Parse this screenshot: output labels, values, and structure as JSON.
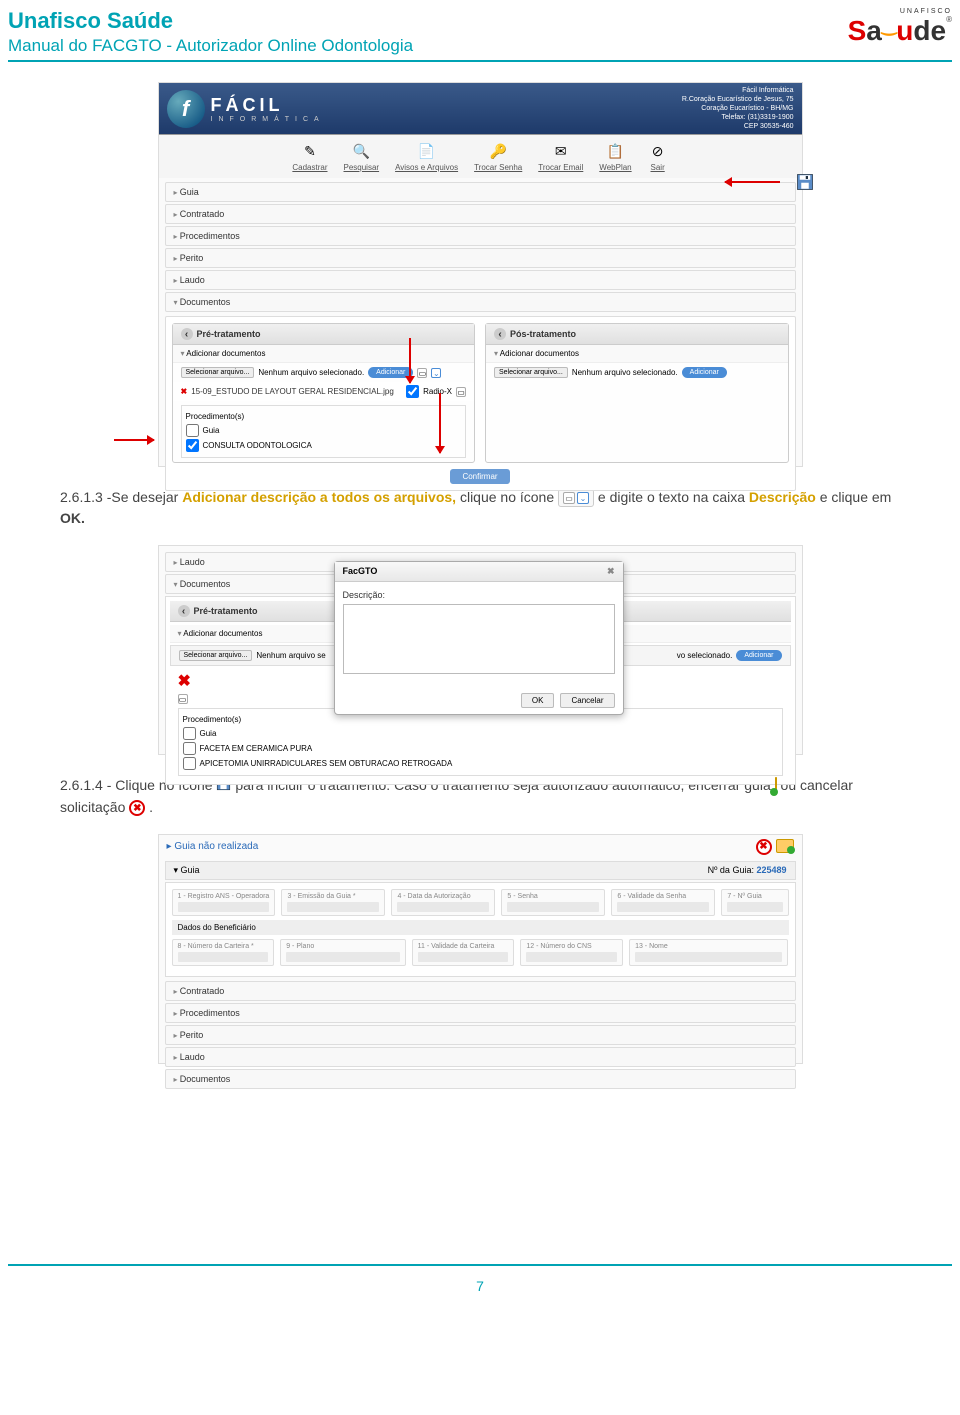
{
  "header": {
    "title": "Unafisco Saúde",
    "subtitle": "Manual do FACGTO - Autorizador Online Odontologia",
    "logo_small": "UNAFISCO",
    "logo_s": "S",
    "logo_a": "a",
    "logo_u": "u",
    "logo_de": "de",
    "logo_r": "®"
  },
  "banner": {
    "brand": "FÁCIL",
    "brand_sub": "INFORMÁTICA",
    "addr1": "Fácil Informática",
    "addr2": "R.Coração Eucarístico de Jesus, 75",
    "addr3": "Coração Eucarístico - BH/MG",
    "addr4": "Telefax: (31)3319-1900",
    "addr5": "CEP 30535-460"
  },
  "toolbar": {
    "items": [
      {
        "icon": "✎",
        "label": "Cadastrar"
      },
      {
        "icon": "🔍",
        "label": "Pesquisar"
      },
      {
        "icon": "📄",
        "label": "Avisos e Arquivos"
      },
      {
        "icon": "🔑",
        "label": "Trocar Senha"
      },
      {
        "icon": "✉",
        "label": "Trocar Email"
      },
      {
        "icon": "📋",
        "label": "WebPlan"
      },
      {
        "icon": "⊘",
        "label": "Sair"
      }
    ]
  },
  "accordion": {
    "items": [
      "Guia",
      "Contratado",
      "Procedimentos",
      "Perito",
      "Laudo",
      "Documentos"
    ]
  },
  "docs": {
    "pre": "Pré-tratamento",
    "pos": "Pós-tratamento",
    "sub": "Adicionar documentos",
    "select": "Selecionar arquivo...",
    "none": "Nenhum arquivo selecionado.",
    "add": "Adicionar",
    "file": "15-09_ESTUDO DE LAYOUT GERAL RESIDENCIAL.jpg",
    "radio": "Radio-X",
    "proc": "Procedimento(s)",
    "guia": "Guia",
    "consulta": "CONSULTA ODONTOLOGICA",
    "confirm": "Confirmar"
  },
  "instr1": {
    "num": "2.6.1.3 -",
    "t1": "Se desejar ",
    "em": "Adicionar descrição a todos os arquivos,",
    "t2": " clique no ícone ",
    "t3": " e digite o texto na caixa ",
    "em2": "Descrição",
    "t4": " e clique em ",
    "ok": "OK."
  },
  "dialog": {
    "title": "FacGTO",
    "label": "Descrição:",
    "ok": "OK",
    "cancel": "Cancelar"
  },
  "ss2bg": {
    "laudo": "Laudo",
    "docs": "Documentos",
    "pre": "Pré-tratamento",
    "add": "Adicionar documentos",
    "select": "Selecionar arquivo...",
    "none": "Nenhum arquivo se",
    "none2": "vo selecionado.",
    "btn": "Adicionar",
    "proc": "Procedimento(s)",
    "guia": "Guia",
    "p1": "FACETA EM CERAMICA PURA",
    "p2": "APICETOMIA UNIRRADICULARES SEM OBTURACAO RETROGADA"
  },
  "instr2": {
    "num": "2.6.1.4 - ",
    "t1": "Clique no ícone ",
    "t2": " para incluir o tratamento. Caso o tratamento seja autorizado automático, encerrar guia ",
    "t3": " ou cancelar solicitação ",
    "t4": " ."
  },
  "ss3": {
    "title": "Guia não realizada",
    "guia": "Guia",
    "guia_label": "Nº da Guia: ",
    "guia_num": "225489",
    "f1": "1 - Registro ANS - Operadora",
    "f2": "3 - Emissão da Guia *",
    "f3": "4 - Data da Autorização",
    "f4": "5 - Senha",
    "f5": "6 - Validade da Senha",
    "f6": "7 - Nº Guia",
    "section": "Dados do Beneficiário",
    "f7": "8 - Número da Carteira *",
    "f8": "9 - Plano",
    "f9": "11 - Validade da Carteira",
    "f10": "12 - Número do CNS",
    "f11": "13 - Nome",
    "acc": [
      "Contratado",
      "Procedimentos",
      "Perito",
      "Laudo",
      "Documentos"
    ]
  },
  "page_number": "7"
}
